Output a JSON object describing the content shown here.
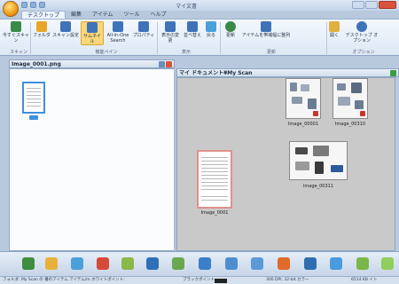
{
  "window": {
    "title": "マイ文書"
  },
  "tabs": [
    "デスクトップ",
    "編集",
    "アイテム",
    "ツール",
    "ヘルプ"
  ],
  "ribbon": {
    "buttons": [
      {
        "label": "今すぐスキャン",
        "color": "#3a8a4a"
      },
      {
        "label": "フォルダ",
        "color": "#e8a528"
      },
      {
        "label": "スキャン設定",
        "color": "#3f73b8"
      },
      {
        "label": "サムネイル",
        "color": "#3f73b8"
      },
      {
        "label": "All-in-One Search",
        "color": "#3f73b8"
      },
      {
        "label": "プロパティ",
        "color": "#3f73b8"
      },
      {
        "label": "表示の変更",
        "color": "#3f73b8"
      },
      {
        "label": "並べ替え",
        "color": "#3f73b8"
      },
      {
        "label": "戻る",
        "color": "#4aa0d8"
      },
      {
        "label": "更新",
        "color": "#3a8a4a"
      },
      {
        "label": "アイテムを帯域幅に整列",
        "color": "#3f73b8"
      },
      {
        "label": "開く",
        "color": "#e0b040"
      },
      {
        "label": "デスクトップ オプション",
        "color": "#3f73b8"
      }
    ],
    "groups": [
      "スキャン",
      "機能ペイン",
      "表示",
      "更新",
      "オプション"
    ]
  },
  "left_panel": {
    "title": "Image_0001.png"
  },
  "right_panel": {
    "title": "マイ ドキュメント¥My Scan",
    "thumbnails": [
      {
        "label": "Image_00001"
      },
      {
        "label": "Image_00310"
      },
      {
        "label": "Image_00311"
      },
      {
        "label": "Image_0001"
      }
    ]
  },
  "dock_colors": [
    "#3f8d3f",
    "#e8b23a",
    "#4aa0d8",
    "#d74a3a",
    "#8ab84a",
    "#2f6fb8",
    "#6aa84f",
    "#3a7fc8",
    "#4d8ed1",
    "#5a9ad6",
    "#e06a2a",
    "#2e6db0",
    "#4a9ae0",
    "#7ab648",
    "#8fcf5a"
  ],
  "status": {
    "path": "フォルダ: My Scan の 番のアイテム アイテム/m ホワイトポイント:",
    "blackpoint": "ブラックポイント",
    "resolution": "300 DPI, 32-bit カラー",
    "size": "6514 KB イト"
  }
}
